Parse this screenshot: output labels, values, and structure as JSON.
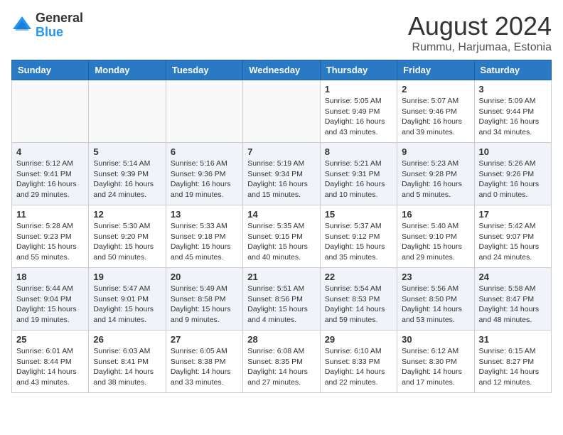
{
  "header": {
    "logo_general": "General",
    "logo_blue": "Blue",
    "month_year": "August 2024",
    "location": "Rummu, Harjumaa, Estonia"
  },
  "days_of_week": [
    "Sunday",
    "Monday",
    "Tuesday",
    "Wednesday",
    "Thursday",
    "Friday",
    "Saturday"
  ],
  "weeks": [
    [
      {
        "day": "",
        "info": ""
      },
      {
        "day": "",
        "info": ""
      },
      {
        "day": "",
        "info": ""
      },
      {
        "day": "",
        "info": ""
      },
      {
        "day": "1",
        "info": "Sunrise: 5:05 AM\nSunset: 9:49 PM\nDaylight: 16 hours\nand 43 minutes."
      },
      {
        "day": "2",
        "info": "Sunrise: 5:07 AM\nSunset: 9:46 PM\nDaylight: 16 hours\nand 39 minutes."
      },
      {
        "day": "3",
        "info": "Sunrise: 5:09 AM\nSunset: 9:44 PM\nDaylight: 16 hours\nand 34 minutes."
      }
    ],
    [
      {
        "day": "4",
        "info": "Sunrise: 5:12 AM\nSunset: 9:41 PM\nDaylight: 16 hours\nand 29 minutes."
      },
      {
        "day": "5",
        "info": "Sunrise: 5:14 AM\nSunset: 9:39 PM\nDaylight: 16 hours\nand 24 minutes."
      },
      {
        "day": "6",
        "info": "Sunrise: 5:16 AM\nSunset: 9:36 PM\nDaylight: 16 hours\nand 19 minutes."
      },
      {
        "day": "7",
        "info": "Sunrise: 5:19 AM\nSunset: 9:34 PM\nDaylight: 16 hours\nand 15 minutes."
      },
      {
        "day": "8",
        "info": "Sunrise: 5:21 AM\nSunset: 9:31 PM\nDaylight: 16 hours\nand 10 minutes."
      },
      {
        "day": "9",
        "info": "Sunrise: 5:23 AM\nSunset: 9:28 PM\nDaylight: 16 hours\nand 5 minutes."
      },
      {
        "day": "10",
        "info": "Sunrise: 5:26 AM\nSunset: 9:26 PM\nDaylight: 16 hours\nand 0 minutes."
      }
    ],
    [
      {
        "day": "11",
        "info": "Sunrise: 5:28 AM\nSunset: 9:23 PM\nDaylight: 15 hours\nand 55 minutes."
      },
      {
        "day": "12",
        "info": "Sunrise: 5:30 AM\nSunset: 9:20 PM\nDaylight: 15 hours\nand 50 minutes."
      },
      {
        "day": "13",
        "info": "Sunrise: 5:33 AM\nSunset: 9:18 PM\nDaylight: 15 hours\nand 45 minutes."
      },
      {
        "day": "14",
        "info": "Sunrise: 5:35 AM\nSunset: 9:15 PM\nDaylight: 15 hours\nand 40 minutes."
      },
      {
        "day": "15",
        "info": "Sunrise: 5:37 AM\nSunset: 9:12 PM\nDaylight: 15 hours\nand 35 minutes."
      },
      {
        "day": "16",
        "info": "Sunrise: 5:40 AM\nSunset: 9:10 PM\nDaylight: 15 hours\nand 29 minutes."
      },
      {
        "day": "17",
        "info": "Sunrise: 5:42 AM\nSunset: 9:07 PM\nDaylight: 15 hours\nand 24 minutes."
      }
    ],
    [
      {
        "day": "18",
        "info": "Sunrise: 5:44 AM\nSunset: 9:04 PM\nDaylight: 15 hours\nand 19 minutes."
      },
      {
        "day": "19",
        "info": "Sunrise: 5:47 AM\nSunset: 9:01 PM\nDaylight: 15 hours\nand 14 minutes."
      },
      {
        "day": "20",
        "info": "Sunrise: 5:49 AM\nSunset: 8:58 PM\nDaylight: 15 hours\nand 9 minutes."
      },
      {
        "day": "21",
        "info": "Sunrise: 5:51 AM\nSunset: 8:56 PM\nDaylight: 15 hours\nand 4 minutes."
      },
      {
        "day": "22",
        "info": "Sunrise: 5:54 AM\nSunset: 8:53 PM\nDaylight: 14 hours\nand 59 minutes."
      },
      {
        "day": "23",
        "info": "Sunrise: 5:56 AM\nSunset: 8:50 PM\nDaylight: 14 hours\nand 53 minutes."
      },
      {
        "day": "24",
        "info": "Sunrise: 5:58 AM\nSunset: 8:47 PM\nDaylight: 14 hours\nand 48 minutes."
      }
    ],
    [
      {
        "day": "25",
        "info": "Sunrise: 6:01 AM\nSunset: 8:44 PM\nDaylight: 14 hours\nand 43 minutes."
      },
      {
        "day": "26",
        "info": "Sunrise: 6:03 AM\nSunset: 8:41 PM\nDaylight: 14 hours\nand 38 minutes."
      },
      {
        "day": "27",
        "info": "Sunrise: 6:05 AM\nSunset: 8:38 PM\nDaylight: 14 hours\nand 33 minutes."
      },
      {
        "day": "28",
        "info": "Sunrise: 6:08 AM\nSunset: 8:35 PM\nDaylight: 14 hours\nand 27 minutes."
      },
      {
        "day": "29",
        "info": "Sunrise: 6:10 AM\nSunset: 8:33 PM\nDaylight: 14 hours\nand 22 minutes."
      },
      {
        "day": "30",
        "info": "Sunrise: 6:12 AM\nSunset: 8:30 PM\nDaylight: 14 hours\nand 17 minutes."
      },
      {
        "day": "31",
        "info": "Sunrise: 6:15 AM\nSunset: 8:27 PM\nDaylight: 14 hours\nand 12 minutes."
      }
    ]
  ]
}
